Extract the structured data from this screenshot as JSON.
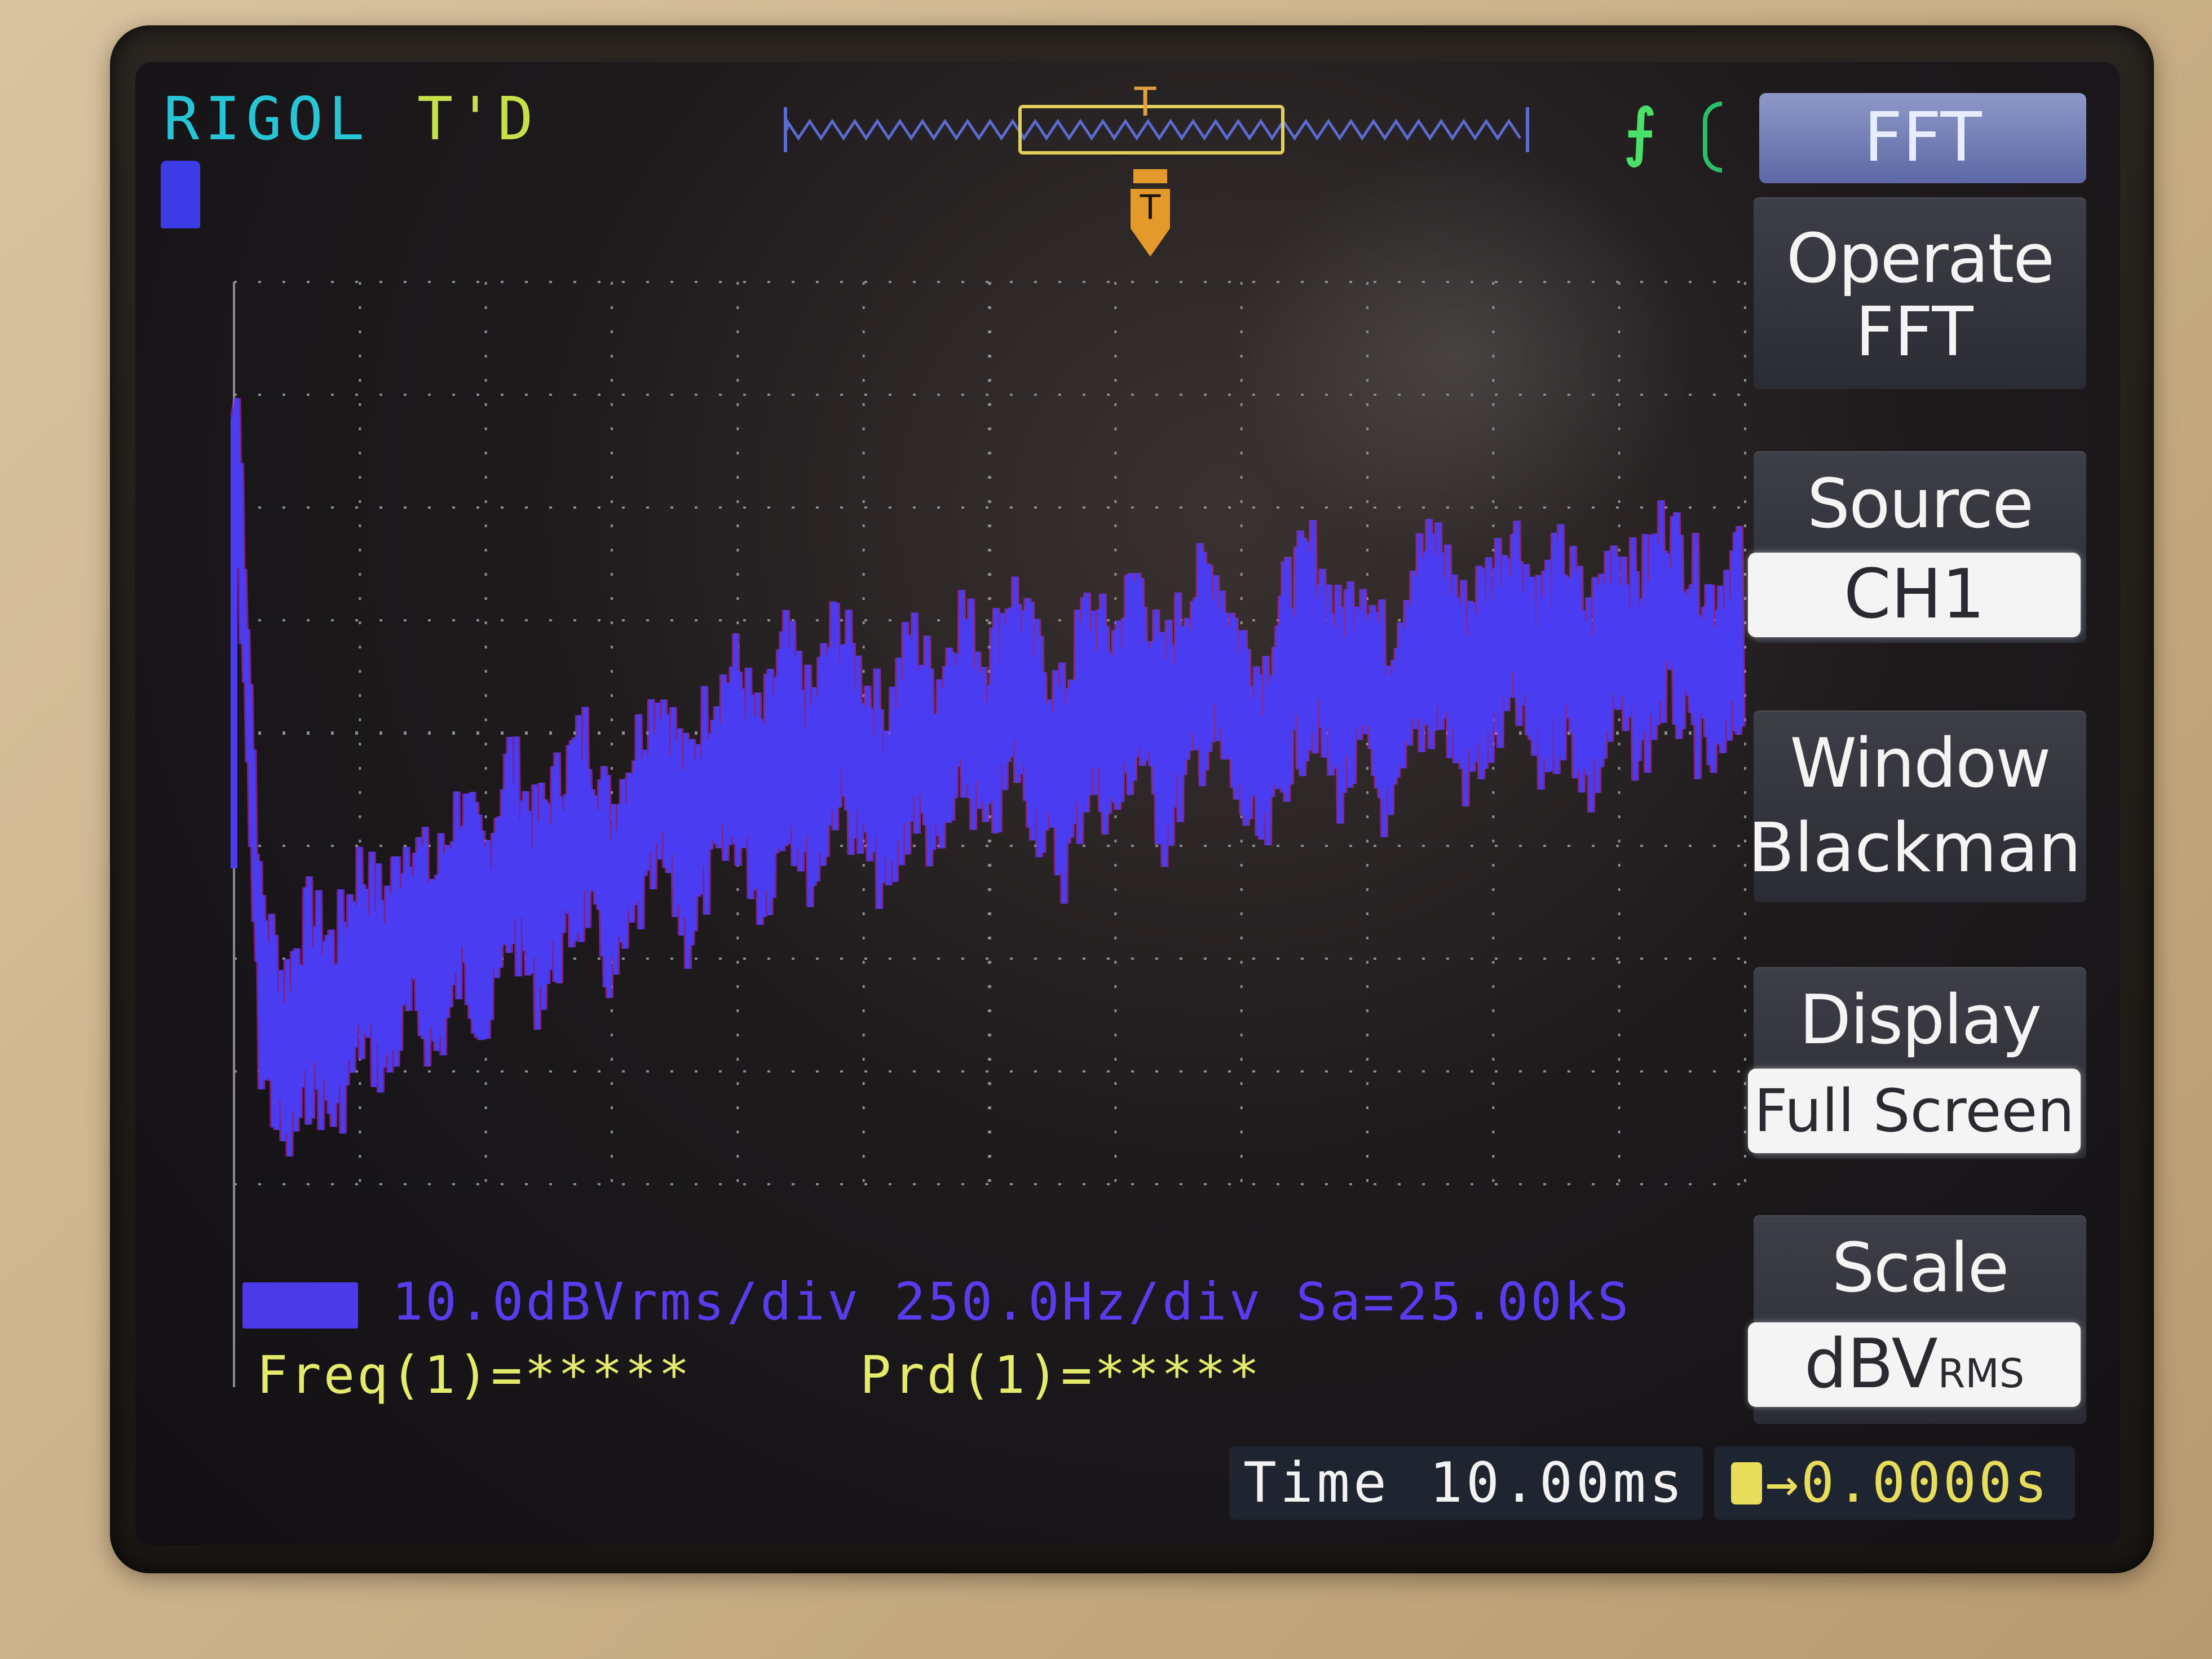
{
  "header": {
    "brand": "RIGOL",
    "trigger_status": "T'D",
    "trigger_edge": "rising",
    "trigger_pos_label": "T"
  },
  "menu": {
    "title": "FFT",
    "items": [
      {
        "label": "Operate",
        "value": "FFT",
        "value_style": "plain"
      },
      {
        "label": "Source",
        "value": "CH1",
        "value_style": "box"
      },
      {
        "label": "Window",
        "value": "Blackman",
        "value_style": "plain"
      },
      {
        "label": "Display",
        "value": "Full Screen",
        "value_style": "box"
      },
      {
        "label": "Scale",
        "value": "dBV",
        "value_suffix": "RMS",
        "value_style": "box"
      }
    ]
  },
  "readout": {
    "math_line": "10.0dBVrms/div 250.0Hz/div Sa=25.00kS",
    "freq": "Freq(1)=*****",
    "period": "Prd(1)=*****"
  },
  "timebase": {
    "time_label": "Time",
    "time_value": "10.00ms",
    "trigger_offset": "0.0000s"
  },
  "colors": {
    "trace": "#4a3cf0",
    "trace_edge": "#d02ad0",
    "grid": "#8a8a90",
    "brand": "#27c6d6",
    "measure": "#e4ea6a"
  },
  "chart_data": {
    "type": "line",
    "title": "",
    "xlabel": "",
    "ylabel": "",
    "x_per_div_hz": 250.0,
    "y_per_div_db": 10.0,
    "x": [
      0,
      50,
      100,
      150,
      200,
      250,
      300,
      350,
      400,
      450,
      500,
      550,
      600,
      650,
      700,
      750,
      800,
      850,
      900,
      950,
      1000,
      1050,
      1100,
      1150,
      1200,
      1250,
      1300,
      1350,
      1400,
      1450,
      1500,
      1550,
      1600,
      1650,
      1700,
      1750,
      1800,
      1850,
      1900,
      1950,
      2000,
      2050,
      2100,
      2150,
      2200,
      2250,
      2300,
      2350,
      2400,
      2450,
      2500,
      2550,
      2600,
      2650,
      2700,
      2750,
      2800,
      2850,
      2900,
      2950,
      3000
    ],
    "y": [
      28,
      -22,
      -30,
      -24,
      -27,
      -20,
      -23,
      -17,
      -21,
      -14,
      -19,
      -10,
      -16,
      -12,
      -8,
      -15,
      -9,
      -4,
      -11,
      -5,
      -2,
      -8,
      0,
      -6,
      2,
      -3,
      -7,
      1,
      -4,
      3,
      -2,
      5,
      -1,
      -5,
      3,
      0,
      6,
      -2,
      4,
      7,
      1,
      -3,
      5,
      8,
      2,
      6,
      -1,
      7,
      9,
      3,
      6,
      10,
      4,
      8,
      2,
      9,
      5,
      11,
      7,
      4,
      9
    ]
  }
}
